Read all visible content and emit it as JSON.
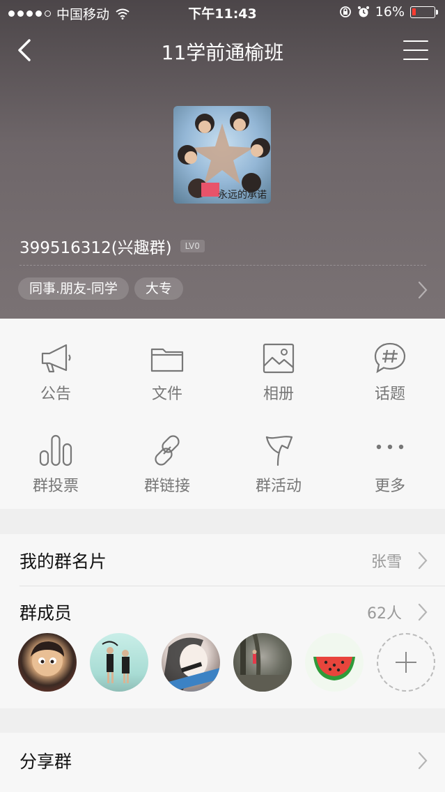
{
  "status_bar": {
    "carrier": "中国移动",
    "time": "下午11:43",
    "battery": "16%",
    "battery_level": 0.16,
    "icons": [
      "signal-dots-icon",
      "wifi-icon",
      "orientation-lock-icon",
      "alarm-icon",
      "battery-icon"
    ]
  },
  "nav": {
    "title": "11学前通榆班",
    "back_icon": "chevron-left-icon",
    "menu_icon": "menu-icon"
  },
  "group": {
    "avatar_caption": "永远的承诺",
    "id_text": "399516312(兴趣群)",
    "level": "LV0",
    "tags": [
      "同事.朋友-同学",
      "大专"
    ]
  },
  "grid": [
    {
      "label": "公告",
      "icon": "megaphone-icon"
    },
    {
      "label": "文件",
      "icon": "folder-icon"
    },
    {
      "label": "相册",
      "icon": "image-icon"
    },
    {
      "label": "话题",
      "icon": "hashtag-bubble-icon"
    },
    {
      "label": "群投票",
      "icon": "bar-chart-icon"
    },
    {
      "label": "群链接",
      "icon": "link-icon"
    },
    {
      "label": "群活动",
      "icon": "flag-icon"
    },
    {
      "label": "更多",
      "icon": "more-icon"
    }
  ],
  "rows": {
    "card": {
      "label": "我的群名片",
      "value": "张雪"
    },
    "members": {
      "label": "群成员",
      "value": "62人"
    },
    "share": {
      "label": "分享群"
    }
  },
  "colors": {
    "header_top": "#4c4649",
    "header_bottom": "#7a7274",
    "icon_gray": "#777777",
    "battery_red": "#ff3b30",
    "watermelon_red": "#e8453c",
    "watermelon_green": "#2f9b3a"
  }
}
